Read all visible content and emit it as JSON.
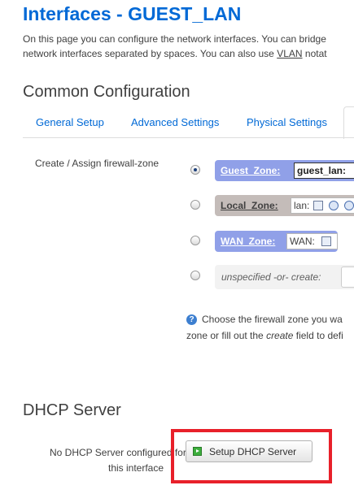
{
  "page": {
    "title": "Interfaces - GUEST_LAN",
    "intro_line_1": "On this page you can configure the network interfaces. You can bridge",
    "intro_line_2_before": "network interfaces separated by spaces. You can also use ",
    "intro_vlan": "VLAN",
    "intro_line_2_after": " notat"
  },
  "common": {
    "title": "Common Configuration",
    "tabs": [
      {
        "label": "General Setup"
      },
      {
        "label": "Advanced Settings"
      },
      {
        "label": "Physical Settings"
      }
    ]
  },
  "firewall": {
    "label": "Create / Assign firewall-zone",
    "options": [
      {
        "name": "Guest_Zone:",
        "value": "guest_lan:",
        "selected": true,
        "color": "#90a0e8"
      },
      {
        "name": "Local_Zone:",
        "value": "lan:",
        "selected": false,
        "color": "#c4bcb9",
        "icons": [
          "network-icon",
          "wifi-icon",
          "wifi-icon"
        ]
      },
      {
        "name": "WAN_Zone:",
        "value": "WAN:",
        "selected": false,
        "color": "#90a0e8",
        "icons": [
          "network-icon"
        ]
      },
      {
        "name": "unspecified -or- create:",
        "selected": false
      }
    ],
    "help_line_1": "Choose the firewall zone you wa",
    "help_line_2_before": "zone or fill out the ",
    "help_create": "create",
    "help_line_2_after": " field to defi"
  },
  "dhcp": {
    "title": "DHCP Server",
    "status_line_1": "No DHCP Server configured for",
    "status_line_2": "this interface",
    "setup_button": "Setup DHCP Server",
    "highlight_color": "#e8202a"
  }
}
